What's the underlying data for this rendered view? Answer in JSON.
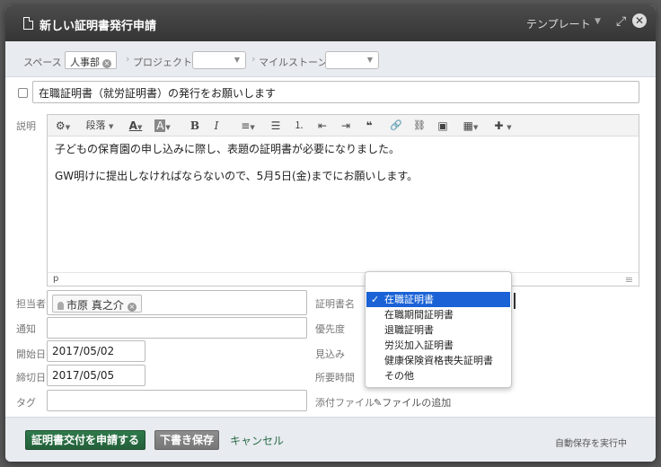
{
  "dialog": {
    "title": "新しい証明書発行申請",
    "template_label": "テンプレート",
    "template_caret": "▼",
    "expand_icon": "⤢",
    "close_icon": "✕"
  },
  "meta": {
    "space_label": "スペース",
    "space_value": "人事部",
    "project_label": "プロジェクト",
    "milestone_label": "マイルストーン",
    "separator": "›",
    "caret": "▼"
  },
  "subject": {
    "value": "在職証明書（就労証明書）の発行をお願いします"
  },
  "description": {
    "label": "説明",
    "toolbar": {
      "settings": "⚙",
      "paragraph": "段落",
      "font_color": "A",
      "bg_color": "A",
      "bold": "B",
      "italic": "I",
      "align": "≡",
      "bullet_list": "☰",
      "numbered_list": "⒈",
      "outdent": "⇤",
      "indent": "⇥",
      "quote": "❝",
      "link": "🔗",
      "unlink": "⛓",
      "image": "▣",
      "table": "▦",
      "plugin": "✚",
      "caret": "▼"
    },
    "paragraphs": [
      "子どもの保育園の申し込みに際し、表題の証明書が必要になりました。",
      "GW明けに提出しなければならないので、5月5日(金)までにお願いします。"
    ],
    "status_path": "p",
    "grip": "≡"
  },
  "fields": {
    "assignee_label": "担当者",
    "assignee_value": "市原 真之介",
    "notify_label": "通知",
    "start_label": "開始日",
    "start_value": "2017/05/02",
    "due_label": "締切日",
    "due_value": "2017/05/05",
    "tags_label": "タグ",
    "cert_label": "証明書名",
    "priority_label": "優先度",
    "estimate_label": "見込み",
    "time_label": "所要時間",
    "attach_label": "添付ファイル",
    "attach_link": "ファイルの追加",
    "x": "×"
  },
  "dropdown": {
    "check": "✓",
    "options": [
      "在職証明書",
      "在職期間証明書",
      "退職証明書",
      "労災加入証明書",
      "健康保険資格喪失証明書",
      "その他"
    ],
    "selected_index": 0
  },
  "footer": {
    "submit": "証明書交付を申請する",
    "draft": "下書き保存",
    "cancel": "キャンセル",
    "autosave": "自動保存を実行中"
  },
  "colors": {
    "primary": "#2f7a4b",
    "selection": "#1a62d6",
    "titlebar": "#3f3f3f"
  }
}
